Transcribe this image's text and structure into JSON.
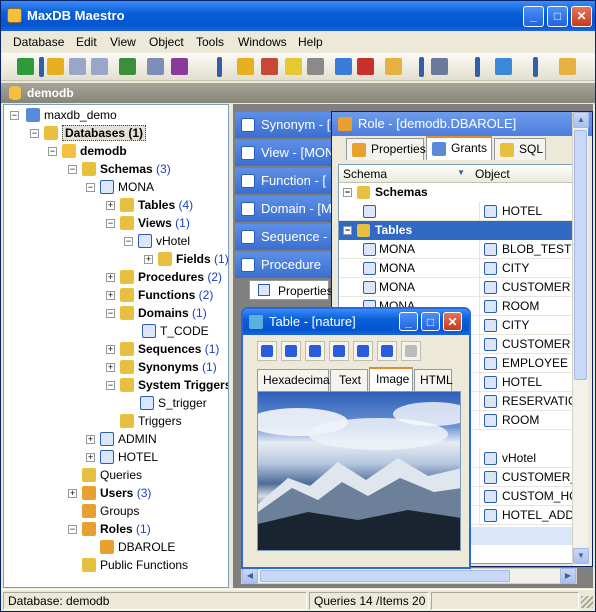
{
  "app": {
    "title": "MaxDB Maestro"
  },
  "window_controls": {
    "minimize": "_",
    "maximize": "□",
    "close": "✕"
  },
  "menu": [
    "Database",
    "Edit",
    "View",
    "Object",
    "Tools",
    "Windows",
    "Help"
  ],
  "db_bar": {
    "label": "demodb"
  },
  "tree": {
    "root": "maxdb_demo",
    "databases": "Databases",
    "databases_count": "(1)",
    "db": "demodb",
    "schemas": "Schemas",
    "schemas_count": "(3)",
    "mona": "MONA",
    "tables": "Tables",
    "tables_count": "(4)",
    "views": "Views",
    "views_count": "(1)",
    "vhotel": "vHotel",
    "fields": "Fields",
    "fields_count": "(1)",
    "procedures": "Procedures",
    "procedures_count": "(2)",
    "functions": "Functions",
    "functions_count": "(2)",
    "domains": "Domains",
    "domains_count": "(1)",
    "t_code": "T_CODE",
    "sequences": "Sequences",
    "sequences_count": "(1)",
    "synonyms": "Synonyms",
    "synonyms_count": "(1)",
    "system_triggers": "System Triggers",
    "s_trigger": "S_trigger",
    "triggers": "Triggers",
    "admin": "ADMIN",
    "hotel": "HOTEL",
    "queries": "Queries",
    "users": "Users",
    "users_count": "(3)",
    "groups": "Groups",
    "roles": "Roles",
    "roles_count": "(1)",
    "dbarole": "DBAROLE",
    "public_functions": "Public Functions"
  },
  "mdi_tabs": [
    "Synonym - [MO",
    "View - [MON",
    "Function - [",
    "Domain - [M",
    "Sequence - [",
    "Procedure"
  ],
  "procedure_properties_tab": "Properties",
  "role_window": {
    "title": "Role - [demodb.DBAROLE]",
    "tabs": [
      "Properties",
      "Grants",
      "SQL"
    ],
    "headers": {
      "schema": "Schema",
      "object": "Object"
    },
    "groups": {
      "schemas": "Schemas",
      "tables": "Tables"
    },
    "schema_row": {
      "object": "HOTEL"
    },
    "rows": [
      {
        "schema": "MONA",
        "object": "BLOB_TEST"
      },
      {
        "schema": "MONA",
        "object": "CITY"
      },
      {
        "schema": "MONA",
        "object": "CUSTOMER"
      },
      {
        "schema": "MONA",
        "object": "ROOM"
      },
      {
        "schema": "",
        "object": "CITY"
      },
      {
        "schema": "",
        "object": "CUSTOMER"
      },
      {
        "schema": "",
        "object": "EMPLOYEE"
      },
      {
        "schema": "",
        "object": "HOTEL"
      },
      {
        "schema": "",
        "object": "RESERVATIO"
      },
      {
        "schema": "",
        "object": "ROOM"
      },
      {
        "schema": "",
        "object": "vHotel"
      },
      {
        "schema": "",
        "object": "CUSTOMER_A"
      },
      {
        "schema": "",
        "object": "CUSTOM_HO"
      },
      {
        "schema": "",
        "object": "HOTEL_ADDR"
      }
    ]
  },
  "table_window": {
    "title": "Table - [nature]",
    "tabs": [
      "Hexadecimal",
      "Text",
      "Image",
      "HTML"
    ]
  },
  "status": {
    "database": "Database: demodb",
    "queries": "Queries 14 /Items 20"
  }
}
